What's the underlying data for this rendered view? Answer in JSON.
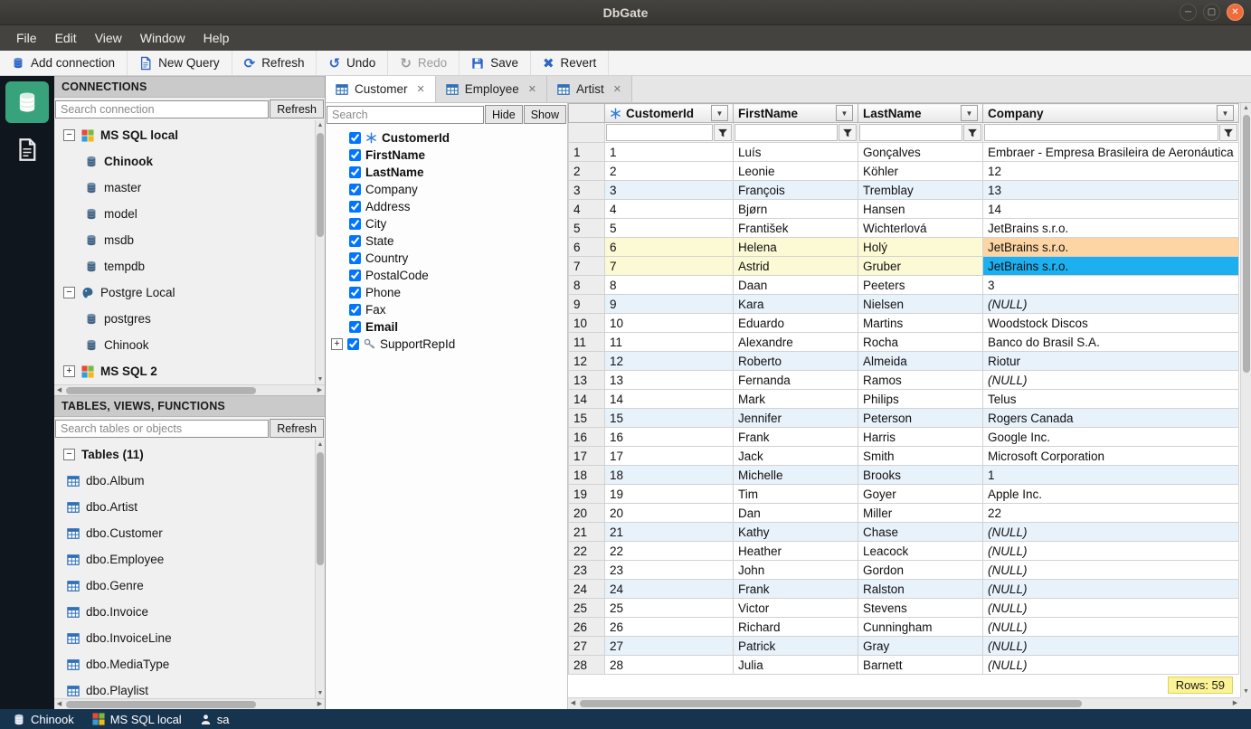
{
  "colors": {
    "accent": "#2c66c4",
    "selected_cell": "#1cb0f1",
    "modified_cell": "#fdd5a4",
    "modified_row": "#fcfad4",
    "alt_row": "#e8f2fb",
    "badge": "#fbf394"
  },
  "window": {
    "title": "DbGate",
    "menu": [
      "File",
      "Edit",
      "View",
      "Window",
      "Help"
    ],
    "controls": [
      {
        "name": "minimize",
        "glyph": "─"
      },
      {
        "name": "maximize",
        "glyph": "▢"
      },
      {
        "name": "close",
        "glyph": "✕"
      }
    ]
  },
  "toolbar": {
    "items": [
      {
        "label": "Add connection",
        "icon": "database"
      },
      {
        "label": "New Query",
        "icon": "file"
      },
      {
        "label": "Refresh",
        "icon": "refresh"
      },
      {
        "label": "Undo",
        "icon": "undo"
      },
      {
        "label": "Redo",
        "icon": "redo",
        "disabled": true
      },
      {
        "label": "Save",
        "icon": "save"
      },
      {
        "label": "Revert",
        "icon": "revert"
      }
    ]
  },
  "connections": {
    "title": "CONNECTIONS",
    "search_placeholder": "Search connection",
    "refresh_label": "Refresh",
    "tree": [
      {
        "label": "MS SQL local",
        "icon": "mssql",
        "expander": "minus",
        "bold": true
      },
      {
        "label": "Chinook",
        "icon": "database",
        "indent": 1,
        "bold": true
      },
      {
        "label": "master",
        "icon": "database",
        "indent": 1
      },
      {
        "label": "model",
        "icon": "database",
        "indent": 1
      },
      {
        "label": "msdb",
        "icon": "database",
        "indent": 1
      },
      {
        "label": "tempdb",
        "icon": "database",
        "indent": 1
      },
      {
        "label": "Postgre Local",
        "icon": "postgres",
        "expander": "minus"
      },
      {
        "label": "postgres",
        "icon": "database",
        "indent": 1
      },
      {
        "label": "Chinook",
        "icon": "database",
        "indent": 1
      },
      {
        "label": "MS SQL 2",
        "icon": "mssql",
        "expander": "plus",
        "bold": true
      }
    ]
  },
  "tables": {
    "title": "TABLES, VIEWS, FUNCTIONS",
    "search_placeholder": "Search tables or objects",
    "refresh_label": "Refresh",
    "group_label": "Tables (11)",
    "items": [
      "dbo.Album",
      "dbo.Artist",
      "dbo.Customer",
      "dbo.Employee",
      "dbo.Genre",
      "dbo.Invoice",
      "dbo.InvoiceLine",
      "dbo.MediaType",
      "dbo.Playlist"
    ]
  },
  "tabs": [
    {
      "label": "Customer",
      "active": true
    },
    {
      "label": "Employee",
      "active": false
    },
    {
      "label": "Artist",
      "active": false
    }
  ],
  "columns": {
    "search_placeholder": "Search",
    "hide_label": "Hide",
    "show_label": "Show",
    "items": [
      {
        "name": "CustomerId",
        "checked": true,
        "bold": true,
        "key": "pk"
      },
      {
        "name": "FirstName",
        "checked": true,
        "bold": true
      },
      {
        "name": "LastName",
        "checked": true,
        "bold": true
      },
      {
        "name": "Company",
        "checked": true
      },
      {
        "name": "Address",
        "checked": true
      },
      {
        "name": "City",
        "checked": true
      },
      {
        "name": "State",
        "checked": true
      },
      {
        "name": "Country",
        "checked": true
      },
      {
        "name": "PostalCode",
        "checked": true
      },
      {
        "name": "Phone",
        "checked": true
      },
      {
        "name": "Fax",
        "checked": true
      },
      {
        "name": "Email",
        "checked": true,
        "bold": true
      },
      {
        "name": "SupportRepId",
        "checked": true,
        "key": "fk",
        "expandable": true
      }
    ]
  },
  "grid": {
    "columns": [
      {
        "label": "CustomerId",
        "key": true
      },
      {
        "label": "FirstName"
      },
      {
        "label": "LastName"
      },
      {
        "label": "Company"
      }
    ],
    "null_text": "(NULL)",
    "rows_badge": "Rows: 59",
    "rows": [
      {
        "n": "1",
        "cells": [
          "1",
          "Luís",
          "Gonçalves",
          "Embraer - Empresa Brasileira de Aeronáutica"
        ]
      },
      {
        "n": "2",
        "cells": [
          "2",
          "Leonie",
          "Köhler",
          "12"
        ]
      },
      {
        "n": "3",
        "cells": [
          "3",
          "François",
          "Tremblay",
          "13"
        ]
      },
      {
        "n": "4",
        "cells": [
          "4",
          "Bjørn",
          "Hansen",
          "14"
        ]
      },
      {
        "n": "5",
        "cells": [
          "5",
          "František",
          "Wichterlová",
          "JetBrains s.r.o."
        ]
      },
      {
        "n": "6",
        "cells": [
          "6",
          "Helena",
          "Holý",
          "JetBrains s.r.o."
        ],
        "modified": true,
        "modified_cell": 3
      },
      {
        "n": "7",
        "cells": [
          "7",
          "Astrid",
          "Gruber",
          "JetBrains s.r.o."
        ],
        "modified": true,
        "selected_cell": 3
      },
      {
        "n": "8",
        "cells": [
          "8",
          "Daan",
          "Peeters",
          "3"
        ]
      },
      {
        "n": "9",
        "cells": [
          "9",
          "Kara",
          "Nielsen",
          "(NULL)"
        ]
      },
      {
        "n": "10",
        "cells": [
          "10",
          "Eduardo",
          "Martins",
          "Woodstock Discos"
        ]
      },
      {
        "n": "11",
        "cells": [
          "11",
          "Alexandre",
          "Rocha",
          "Banco do Brasil S.A."
        ]
      },
      {
        "n": "12",
        "cells": [
          "12",
          "Roberto",
          "Almeida",
          "Riotur"
        ]
      },
      {
        "n": "13",
        "cells": [
          "13",
          "Fernanda",
          "Ramos",
          "(NULL)"
        ]
      },
      {
        "n": "14",
        "cells": [
          "14",
          "Mark",
          "Philips",
          "Telus"
        ]
      },
      {
        "n": "15",
        "cells": [
          "15",
          "Jennifer",
          "Peterson",
          "Rogers Canada"
        ]
      },
      {
        "n": "16",
        "cells": [
          "16",
          "Frank",
          "Harris",
          "Google Inc."
        ]
      },
      {
        "n": "17",
        "cells": [
          "17",
          "Jack",
          "Smith",
          "Microsoft Corporation"
        ]
      },
      {
        "n": "18",
        "cells": [
          "18",
          "Michelle",
          "Brooks",
          "1"
        ]
      },
      {
        "n": "19",
        "cells": [
          "19",
          "Tim",
          "Goyer",
          "Apple Inc."
        ]
      },
      {
        "n": "20",
        "cells": [
          "20",
          "Dan",
          "Miller",
          "22"
        ]
      },
      {
        "n": "21",
        "cells": [
          "21",
          "Kathy",
          "Chase",
          "(NULL)"
        ]
      },
      {
        "n": "22",
        "cells": [
          "22",
          "Heather",
          "Leacock",
          "(NULL)"
        ]
      },
      {
        "n": "23",
        "cells": [
          "23",
          "John",
          "Gordon",
          "(NULL)"
        ]
      },
      {
        "n": "24",
        "cells": [
          "24",
          "Frank",
          "Ralston",
          "(NULL)"
        ]
      },
      {
        "n": "25",
        "cells": [
          "25",
          "Victor",
          "Stevens",
          "(NULL)"
        ]
      },
      {
        "n": "26",
        "cells": [
          "26",
          "Richard",
          "Cunningham",
          "(NULL)"
        ]
      },
      {
        "n": "27",
        "cells": [
          "27",
          "Patrick",
          "Gray",
          "(NULL)"
        ]
      },
      {
        "n": "28",
        "cells": [
          "28",
          "Julia",
          "Barnett",
          "(NULL)"
        ]
      }
    ]
  },
  "statusbar": {
    "items": [
      {
        "label": "Chinook",
        "icon": "database"
      },
      {
        "label": "MS SQL local",
        "icon": "mssql"
      },
      {
        "label": "sa",
        "icon": "user"
      }
    ]
  }
}
